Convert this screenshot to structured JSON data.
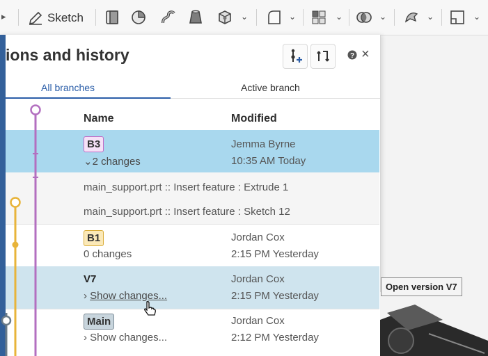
{
  "toolbar": {
    "sketch_label": "Sketch",
    "icons": [
      "extrude-icon",
      "revolve-icon",
      "sweep-icon",
      "loft-icon",
      "thicken-icon",
      "fillet-icon",
      "pattern-icon",
      "boolean-icon",
      "transform-icon",
      "plane-icon"
    ]
  },
  "panel": {
    "title": "ions and history",
    "tabs": [
      {
        "label": "All branches",
        "active": true
      },
      {
        "label": "Active branch",
        "active": false
      }
    ],
    "columns": {
      "name": "Name",
      "modified": "Modified"
    },
    "rows": {
      "b3": {
        "badge": "B3",
        "changes": "2 changes",
        "author": "Jemma Byrne",
        "time": "10:35 AM Today"
      },
      "change_items": [
        "main_support.prt :: Insert feature : Extrude 1",
        "main_support.prt :: Insert feature : Sketch 12"
      ],
      "b1": {
        "badge": "B1",
        "changes": "0 changes",
        "author": "Jordan Cox",
        "time": "2:15 PM Yesterday"
      },
      "v7": {
        "name": "V7",
        "changes": "Show changes...",
        "author": "Jordan Cox",
        "time": "2:15 PM Yesterday"
      },
      "main": {
        "badge": "Main",
        "changes": "Show changes...",
        "author": "Jordan Cox",
        "time": "2:12 PM Yesterday"
      }
    }
  },
  "tooltip": "Open version V7",
  "colors": {
    "accent": "#2a5da8",
    "b3_branch": "#b36fc0",
    "b1_branch": "#e8b43a",
    "selected_row": "#a9d8ee",
    "hover_row": "#cfe4ee"
  }
}
